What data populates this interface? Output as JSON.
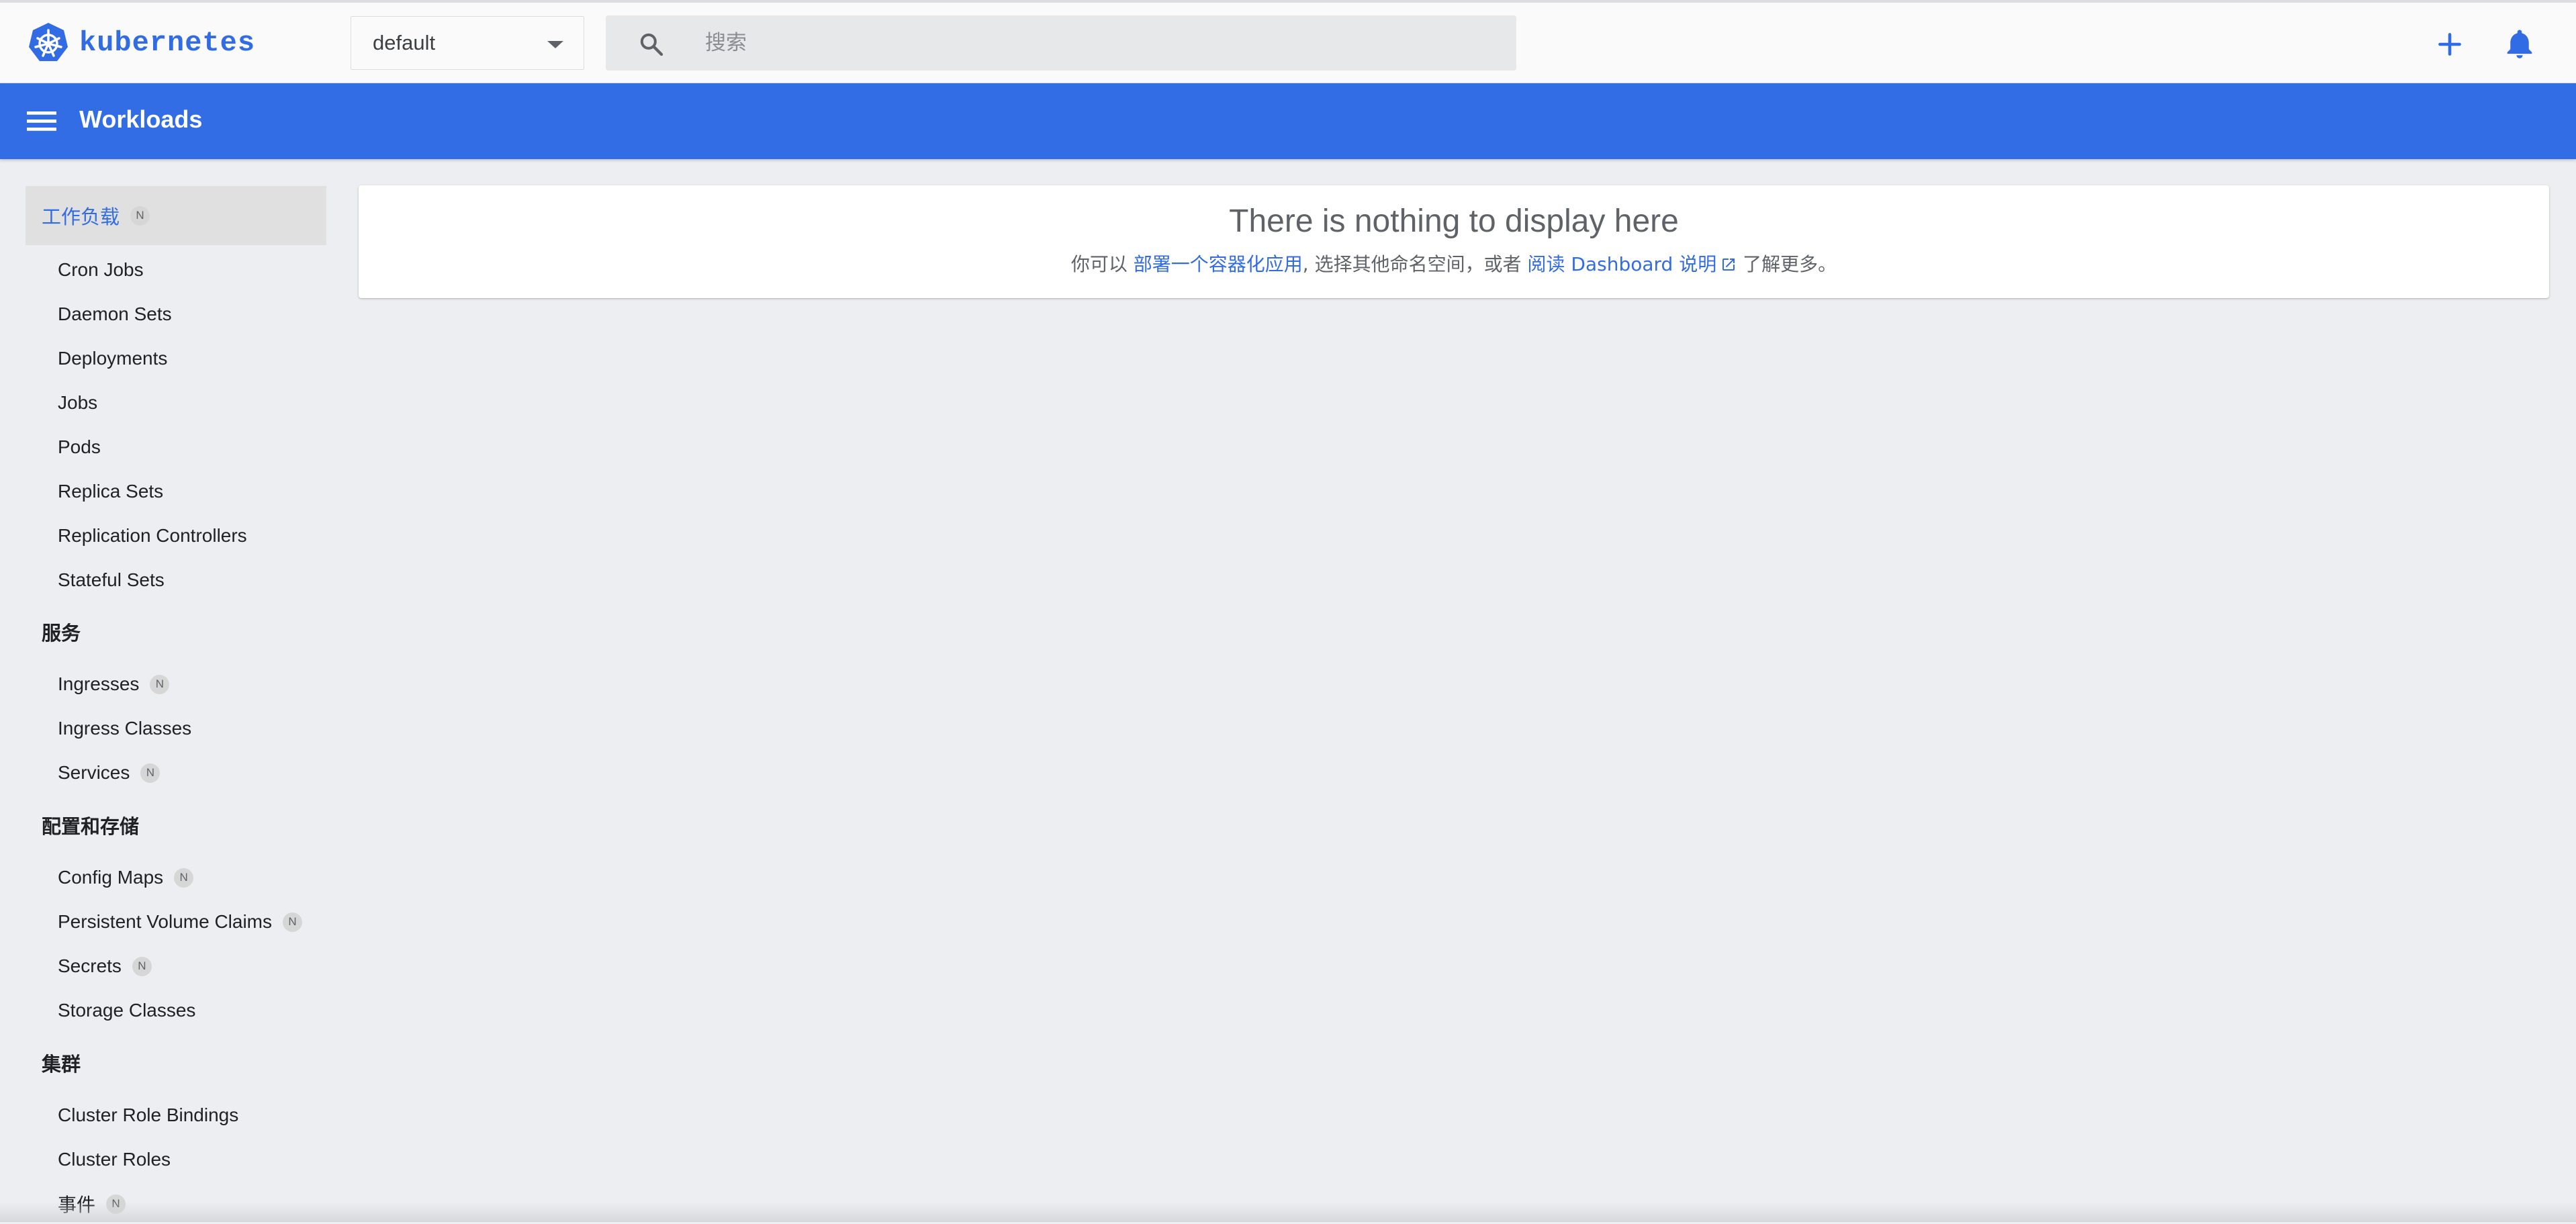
{
  "app": {
    "brand": "kubernetes"
  },
  "toolbar": {
    "namespace": {
      "selected": "default"
    },
    "search": {
      "placeholder": "搜索"
    },
    "add_icon": "plus-icon",
    "notifications_icon": "bell-icon"
  },
  "titlebar": {
    "menu_icon": "menu-icon",
    "title": "Workloads"
  },
  "sidebar": {
    "active": {
      "label": "工作负载",
      "badge": "N"
    },
    "workloads_items": [
      {
        "label": "Cron Jobs"
      },
      {
        "label": "Daemon Sets"
      },
      {
        "label": "Deployments"
      },
      {
        "label": "Jobs"
      },
      {
        "label": "Pods"
      },
      {
        "label": "Replica Sets"
      },
      {
        "label": "Replication Controllers"
      },
      {
        "label": "Stateful Sets"
      }
    ],
    "services": {
      "header": "服务",
      "items": [
        {
          "label": "Ingresses",
          "badge": "N"
        },
        {
          "label": "Ingress Classes"
        },
        {
          "label": "Services",
          "badge": "N"
        }
      ]
    },
    "config": {
      "header": "配置和存储",
      "items": [
        {
          "label": "Config Maps",
          "badge": "N"
        },
        {
          "label": "Persistent Volume Claims",
          "badge": "N"
        },
        {
          "label": "Secrets",
          "badge": "N"
        },
        {
          "label": "Storage Classes"
        }
      ]
    },
    "cluster": {
      "header": "集群",
      "items": [
        {
          "label": "Cluster Role Bindings"
        },
        {
          "label": "Cluster Roles"
        },
        {
          "label": "事件",
          "badge": "N"
        }
      ]
    }
  },
  "main": {
    "empty_state": {
      "title": "There is nothing to display here",
      "text_before": "你可以 ",
      "link_deploy": "部署一个容器化应用",
      "text_middle": ", 选择其他命名空间，或者 ",
      "link_docs": "阅读 Dashboard 说明",
      "text_after": " 了解更多。"
    }
  },
  "colors": {
    "accent": "#326ce5",
    "titlebar": "#326de6",
    "background": "#edeef1"
  }
}
